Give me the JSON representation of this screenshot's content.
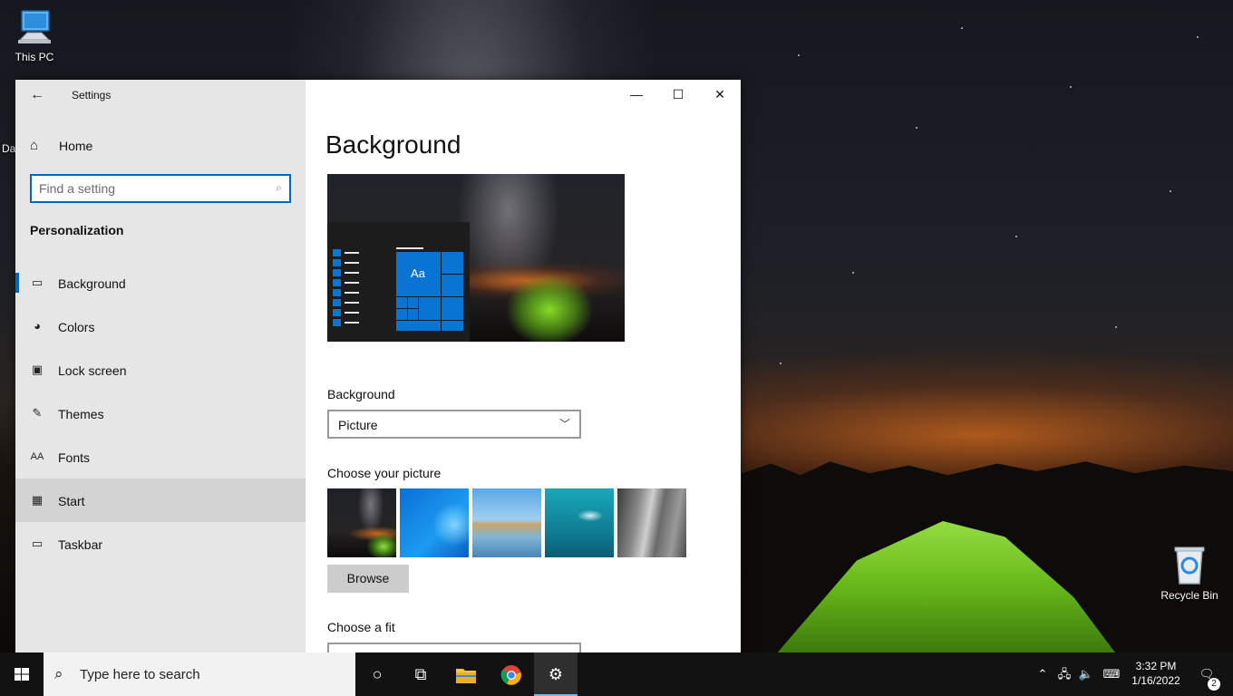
{
  "desktop": {
    "icons": [
      {
        "label": "This PC",
        "icon": "this-pc-icon"
      },
      {
        "label": "Recycle Bin",
        "icon": "recycle-bin-icon"
      }
    ],
    "partial_label": "Da"
  },
  "window": {
    "app_title": "Settings",
    "home_label": "Home",
    "search": {
      "placeholder": "Find a setting"
    },
    "section_heading": "Personalization",
    "nav": [
      {
        "label": "Background",
        "icon": "picture-icon",
        "selected": true
      },
      {
        "label": "Colors",
        "icon": "palette-icon"
      },
      {
        "label": "Lock screen",
        "icon": "lock-screen-icon"
      },
      {
        "label": "Themes",
        "icon": "themes-icon"
      },
      {
        "label": "Fonts",
        "icon": "fonts-icon"
      },
      {
        "label": "Start",
        "icon": "start-icon",
        "hovered": true
      },
      {
        "label": "Taskbar",
        "icon": "taskbar-icon"
      }
    ],
    "controls": {
      "minimize": "—",
      "maximize": "☐",
      "close": "✕"
    },
    "content": {
      "page_title": "Background",
      "preview_tile_text": "Aa",
      "background_label": "Background",
      "background_value": "Picture",
      "choose_picture_label": "Choose your picture",
      "browse_label": "Browse",
      "choose_fit_label": "Choose a fit"
    }
  },
  "taskbar": {
    "search_text": "Type here to search",
    "time": "3:32 PM",
    "date": "1/16/2022",
    "notification_count": "2"
  },
  "colors": {
    "accent": "#0067c0",
    "taskbar": "#121212",
    "sidebar": "#e6e6e6"
  }
}
